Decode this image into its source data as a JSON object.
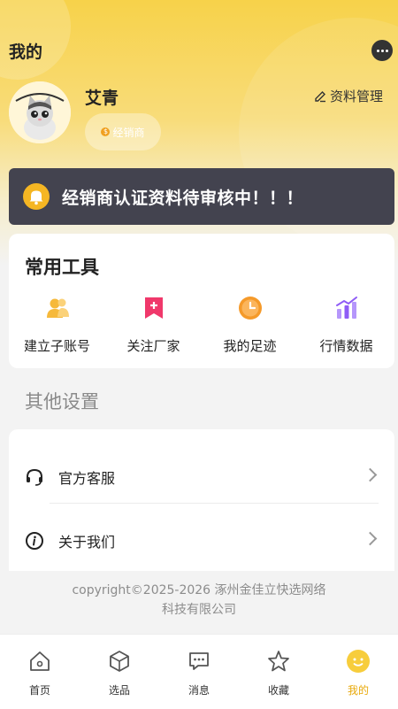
{
  "header": {
    "title": "我的",
    "user": {
      "name": "艾青",
      "role": "经销商"
    },
    "profile_manage": "资料管理",
    "avatar_icon": "cat-avatar-icon"
  },
  "notice": {
    "text": "经销商认证资料待审核中！！！"
  },
  "tools": {
    "title": "常用工具",
    "items": [
      {
        "label": "建立子账号",
        "icon": "user-add-icon",
        "color": "#f6b93b"
      },
      {
        "label": "关注厂家",
        "icon": "bookmark-plus-icon",
        "color": "#f0386b"
      },
      {
        "label": "我的足迹",
        "icon": "clock-icon",
        "color": "#f59a2a"
      },
      {
        "label": "行情数据",
        "icon": "bar-chart-icon",
        "color": "#8f5cf6"
      }
    ]
  },
  "other": {
    "title": "其他设置",
    "rows": [
      {
        "label": "官方客服",
        "icon": "headset-icon"
      },
      {
        "label": "关于我们",
        "icon": "info-icon"
      }
    ]
  },
  "footer": {
    "line1": "copyright©2025-2026 涿州金佳立快选网络",
    "line2": "科技有限公司"
  },
  "tabbar": [
    {
      "label": "首页",
      "icon": "home-icon"
    },
    {
      "label": "选品",
      "icon": "cube-icon"
    },
    {
      "label": "消息",
      "icon": "message-icon"
    },
    {
      "label": "收藏",
      "icon": "star-icon"
    },
    {
      "label": "我的",
      "icon": "profile-icon",
      "active": true
    }
  ],
  "colors": {
    "accent": "#f7d24a",
    "active_tab": "#e8a90a",
    "notice_bg": "#43434f"
  }
}
